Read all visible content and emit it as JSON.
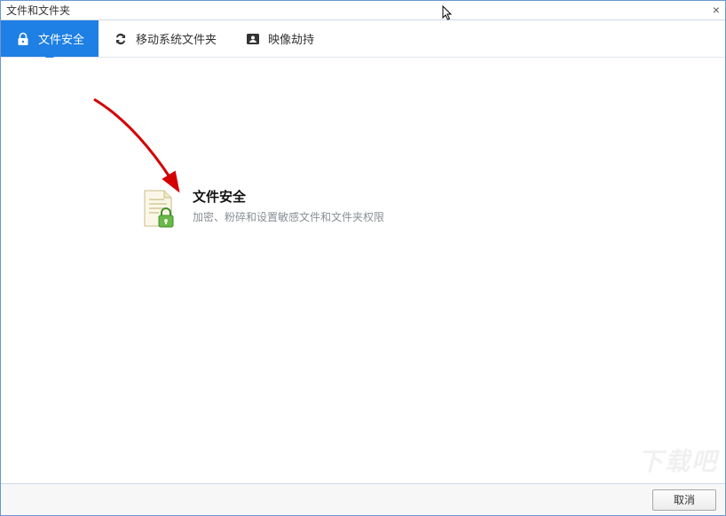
{
  "window": {
    "title": "文件和文件夹",
    "close_label": "×"
  },
  "tabs": [
    {
      "id": "file-security",
      "label": "文件安全",
      "icon": "lock-icon",
      "active": true
    },
    {
      "id": "move-system-folders",
      "label": "移动系统文件夹",
      "icon": "refresh-icon",
      "active": false
    },
    {
      "id": "image-hijack",
      "label": "映像劫持",
      "icon": "person-card-icon",
      "active": false
    }
  ],
  "main": {
    "card": {
      "title": "文件安全",
      "description": "加密、粉碎和设置敏感文件和文件夹权限"
    }
  },
  "footer": {
    "cancel_label": "取消"
  },
  "watermark": "下载吧"
}
